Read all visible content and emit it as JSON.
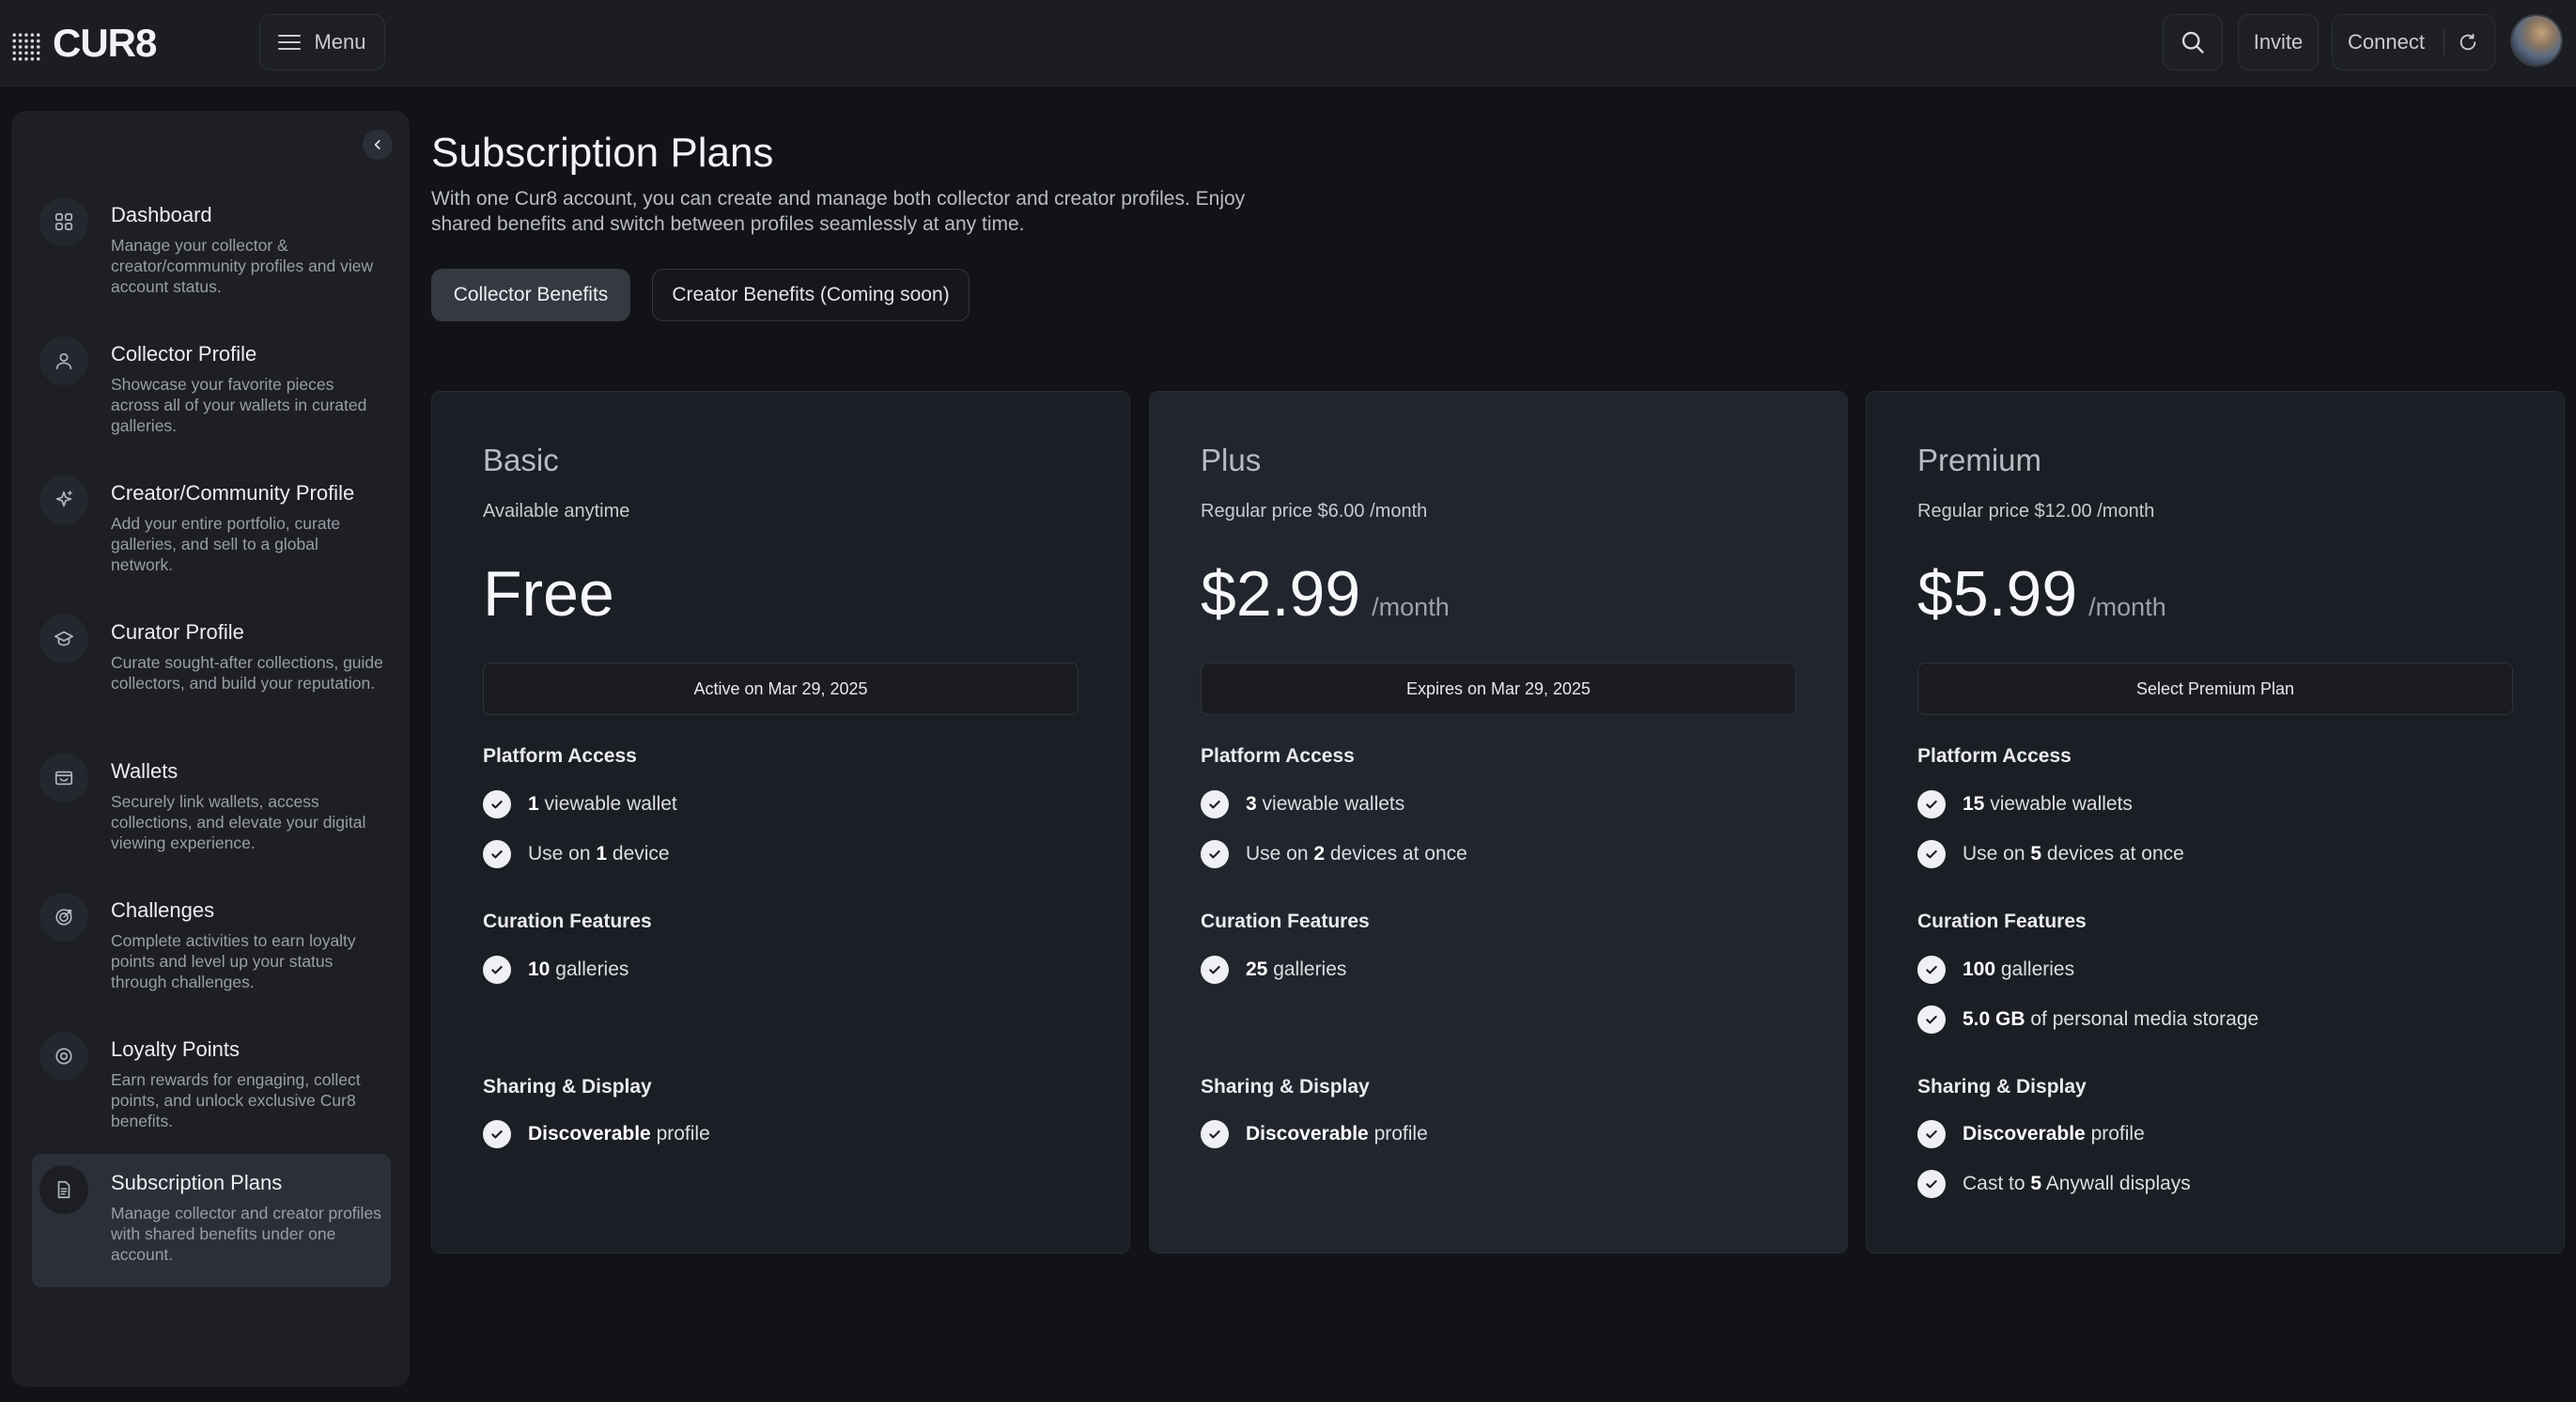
{
  "brand": {
    "name": "CUR8"
  },
  "topbar": {
    "menu_label": "Menu",
    "invite_label": "Invite",
    "connect_label": "Connect"
  },
  "sidebar": {
    "items": [
      {
        "title": "Dashboard",
        "desc": "Manage your collector & creator/community profiles and view account status.",
        "icon": "dashboard-icon"
      },
      {
        "title": "Collector Profile",
        "desc": "Showcase your favorite pieces across all of your wallets in curated galleries.",
        "icon": "user-icon"
      },
      {
        "title": "Creator/Community Profile",
        "desc": "Add your entire portfolio, curate galleries, and sell to a global network.",
        "icon": "sparkle-icon"
      },
      {
        "title": "Curator Profile",
        "desc": "Curate sought-after collections, guide collectors, and build your reputation.",
        "icon": "graduation-cap-icon"
      },
      {
        "title": "Wallets",
        "desc": "Securely link wallets, access collections, and elevate your digital viewing experience.",
        "icon": "wallet-icon"
      },
      {
        "title": "Challenges",
        "desc": "Complete activities to earn loyalty points and level up your status through challenges.",
        "icon": "target-icon"
      },
      {
        "title": "Loyalty Points",
        "desc": "Earn rewards for engaging, collect points, and unlock exclusive Cur8 benefits.",
        "icon": "points-icon"
      },
      {
        "title": "Subscription Plans",
        "desc": "Manage collector and creator profiles with shared benefits under one account.",
        "icon": "document-icon",
        "active": true
      }
    ]
  },
  "main": {
    "title": "Subscription Plans",
    "description": "With one Cur8 account, you can create and manage both collector and creator profiles. Enjoy shared benefits and switch between profiles seamlessly at any time.",
    "tabs": [
      {
        "label": "Collector Benefits",
        "active": true
      },
      {
        "label": "Creator Benefits (Coming soon)",
        "active": false
      }
    ]
  },
  "plans": [
    {
      "name": "Basic",
      "subtitle": "Available anytime",
      "price": "Free",
      "period": "",
      "action": "Active on Mar 29, 2025",
      "sections": {
        "platform": "Platform Access",
        "curation": "Curation Features",
        "sharing": "Sharing & Display"
      },
      "platform": [
        {
          "bold": "1",
          "pre": "",
          "post": " viewable wallet"
        },
        {
          "pre": "Use on ",
          "bold": "1",
          "post": " device"
        }
      ],
      "curation": [
        {
          "bold": "10",
          "pre": "",
          "post": " galleries"
        }
      ],
      "sharing": [
        {
          "bold": "Discoverable",
          "pre": "",
          "post": " profile"
        }
      ]
    },
    {
      "name": "Plus",
      "subtitle": "Regular price $6.00 /month",
      "price": "$2.99",
      "period": "/month",
      "action": "Expires on Mar 29, 2025",
      "sections": {
        "platform": "Platform Access",
        "curation": "Curation Features",
        "sharing": "Sharing & Display"
      },
      "platform": [
        {
          "bold": "3",
          "pre": "",
          "post": " viewable wallets"
        },
        {
          "pre": "Use on ",
          "bold": "2",
          "post": " devices at once"
        }
      ],
      "curation": [
        {
          "bold": "25",
          "pre": "",
          "post": " galleries"
        }
      ],
      "sharing": [
        {
          "bold": "Discoverable",
          "pre": "",
          "post": " profile"
        }
      ]
    },
    {
      "name": "Premium",
      "subtitle": "Regular price $12.00 /month",
      "price": "$5.99",
      "period": "/month",
      "action": "Select Premium Plan",
      "sections": {
        "platform": "Platform Access",
        "curation": "Curation Features",
        "sharing": "Sharing & Display"
      },
      "platform": [
        {
          "bold": "15",
          "pre": "",
          "post": " viewable wallets"
        },
        {
          "pre": "Use on ",
          "bold": "5",
          "post": " devices at once"
        }
      ],
      "curation": [
        {
          "bold": "100",
          "pre": "",
          "post": " galleries"
        },
        {
          "bold": "5.0 GB",
          "pre": "",
          "post": " of personal media storage"
        }
      ],
      "sharing": [
        {
          "bold": "Discoverable",
          "pre": "",
          "post": " profile"
        },
        {
          "pre": "Cast to ",
          "bold": "5",
          "post": " Anywall displays"
        }
      ]
    }
  ]
}
